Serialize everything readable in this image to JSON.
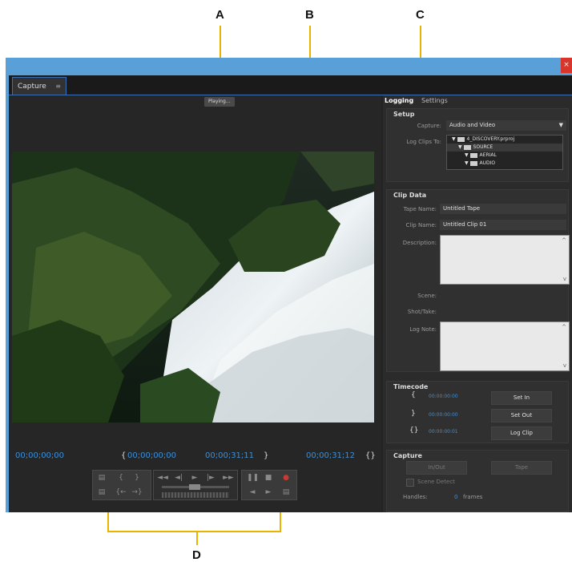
{
  "callouts": {
    "a": "A",
    "b": "B",
    "c": "C",
    "d": "D"
  },
  "window": {
    "close_glyph": "×"
  },
  "tab": {
    "label": "Capture",
    "menu_glyph": "≡"
  },
  "preview": {
    "status": "Playing..."
  },
  "timecodes": {
    "current": "00;00;00;00",
    "in_point": "00;00;00;00",
    "out_point": "00;00;31;11",
    "duration": "00;00;31;12",
    "in_bracket": "{",
    "out_bracket": "}",
    "duration_glyph": "{}"
  },
  "transport": {
    "clip_icon": "clapboard-icon",
    "set_in": "{",
    "set_out": "}",
    "goto_in": "{←",
    "goto_out": "→}",
    "rewind": "◄◄",
    "step_back": "◄|",
    "play": "►",
    "step_forward": "|►",
    "fast_forward": "►►",
    "pause": "❚❚",
    "stop": "■",
    "record": "●",
    "shuttle_left": "◄",
    "shuttle_right": "►"
  },
  "panel_tabs": {
    "logging": "Logging",
    "settings": "Settings"
  },
  "setup": {
    "title": "Setup",
    "capture_label": "Capture:",
    "capture_value": "Audio and Video",
    "dropdown_glyph": "▼",
    "log_clips_label": "Log Clips To:",
    "bins": [
      "4_DISCOVERY.prproj",
      "SOURCE",
      "AERIAL",
      "AUDIO"
    ],
    "expand_glyph": "▼"
  },
  "clip_data": {
    "title": "Clip Data",
    "tape_name_label": "Tape Name:",
    "tape_name_value": "Untitled Tape",
    "clip_name_label": "Clip Name:",
    "clip_name_value": "Untitled Clip 01",
    "description_label": "Description:",
    "scene_label": "Scene:",
    "shot_take_label": "Shot/Take:",
    "log_note_label": "Log Note:",
    "scroll_up": "^",
    "scroll_down": "v"
  },
  "timecode": {
    "title": "Timecode",
    "in_glyph": "{",
    "out_glyph": "}",
    "dur_glyph": "{}",
    "in_value": "00:00:00:00",
    "out_value": "00:00:00:00",
    "duration_value": "00:00:00:01",
    "set_in": "Set In",
    "set_out": "Set Out",
    "log_clip": "Log Clip"
  },
  "capture": {
    "title": "Capture",
    "in_out": "In/Out",
    "tape": "Tape",
    "scene_detect": "Scene Detect",
    "handles_label": "Handles:",
    "handles_value": "0",
    "handles_unit": "frames"
  },
  "colors": {
    "accent": "#3b8fd9",
    "frame": "#5aa0d8",
    "callout_line": "#e8b400",
    "record": "#c83a30"
  }
}
